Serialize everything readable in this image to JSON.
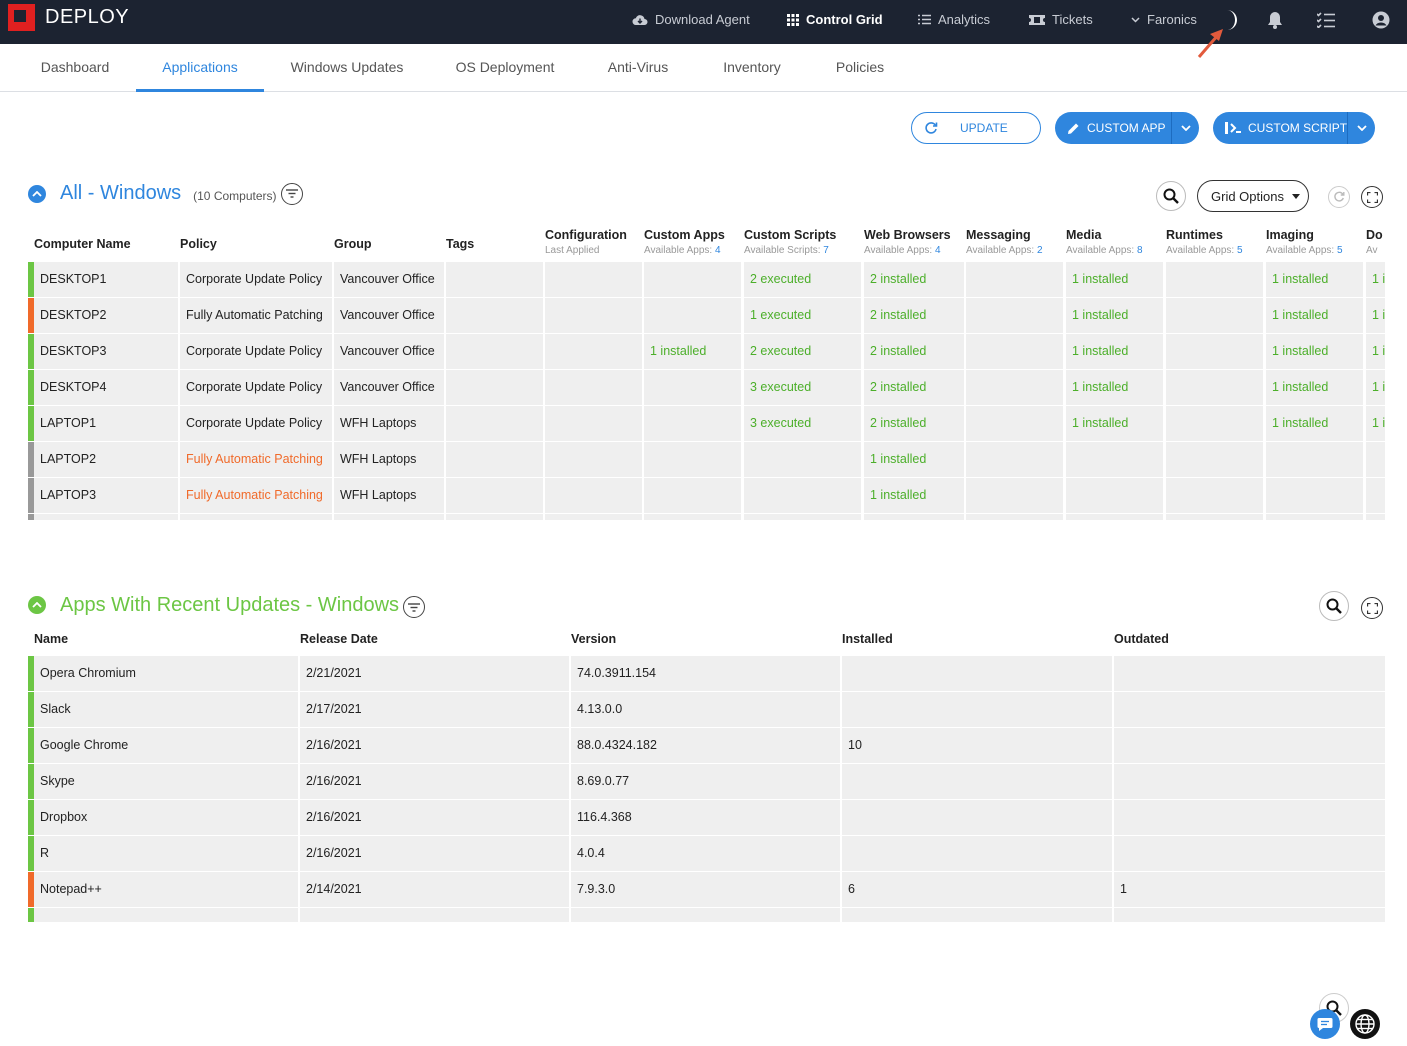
{
  "app": {
    "name": "DEPLOY"
  },
  "topnav": {
    "download_agent": "Download Agent",
    "control_grid": "Control Grid",
    "analytics": "Analytics",
    "tickets": "Tickets",
    "account": "Faronics"
  },
  "tabs": [
    "Dashboard",
    "Applications",
    "Windows Updates",
    "OS Deployment",
    "Anti-Virus",
    "Inventory",
    "Policies"
  ],
  "actions": {
    "update": "UPDATE",
    "custom_app": "CUSTOM APP",
    "custom_script": "CUSTOM SCRIPT"
  },
  "grid1": {
    "title": "All - Windows",
    "count": "(10 Computers)",
    "grid_options": "Grid Options",
    "columns": [
      {
        "label": "Computer Name",
        "sub_label": "",
        "sub_value": ""
      },
      {
        "label": "Policy",
        "sub_label": "",
        "sub_value": ""
      },
      {
        "label": "Group",
        "sub_label": "",
        "sub_value": ""
      },
      {
        "label": "Tags",
        "sub_label": "",
        "sub_value": ""
      },
      {
        "label": "Configuration",
        "sub_label": "Last Applied",
        "sub_value": ""
      },
      {
        "label": "Custom Apps",
        "sub_label": "Available Apps: ",
        "sub_value": "4"
      },
      {
        "label": "Custom Scripts",
        "sub_label": "Available Scripts: ",
        "sub_value": "7"
      },
      {
        "label": "Web Browsers",
        "sub_label": "Available Apps: ",
        "sub_value": "4"
      },
      {
        "label": "Messaging",
        "sub_label": "Available Apps: ",
        "sub_value": "2"
      },
      {
        "label": "Media",
        "sub_label": "Available Apps: ",
        "sub_value": "8"
      },
      {
        "label": "Runtimes",
        "sub_label": "Available Apps: ",
        "sub_value": "5"
      },
      {
        "label": "Imaging",
        "sub_label": "Available Apps: ",
        "sub_value": "5"
      },
      {
        "label": "Do",
        "sub_label": "Av",
        "sub_value": ""
      }
    ],
    "rows": [
      {
        "status": "green",
        "name": "DESKTOP1",
        "policy": "Corporate Update Policy",
        "policy_warn": false,
        "group": "Vancouver Office",
        "tags": "",
        "config": "",
        "custom_apps": "",
        "custom_scripts": "2 executed",
        "web_browsers": "2 installed",
        "messaging": "",
        "media": "1 installed",
        "runtimes": "",
        "imaging": "1 installed",
        "last": "1 i"
      },
      {
        "status": "orange",
        "name": "DESKTOP2",
        "policy": "Fully Automatic Patching",
        "policy_warn": false,
        "group": "Vancouver Office",
        "tags": "",
        "config": "",
        "custom_apps": "",
        "custom_scripts": "1 executed",
        "web_browsers": "2 installed",
        "messaging": "",
        "media": "1 installed",
        "runtimes": "",
        "imaging": "1 installed",
        "last": "1 i"
      },
      {
        "status": "green",
        "name": "DESKTOP3",
        "policy": "Corporate Update Policy",
        "policy_warn": false,
        "group": "Vancouver Office",
        "tags": "",
        "config": "",
        "custom_apps": "1 installed",
        "custom_scripts": "2 executed",
        "web_browsers": "2 installed",
        "messaging": "",
        "media": "1 installed",
        "runtimes": "",
        "imaging": "1 installed",
        "last": "1 i"
      },
      {
        "status": "green",
        "name": "DESKTOP4",
        "policy": "Corporate Update Policy",
        "policy_warn": false,
        "group": "Vancouver Office",
        "tags": "",
        "config": "",
        "custom_apps": "",
        "custom_scripts": "3 executed",
        "web_browsers": "2 installed",
        "messaging": "",
        "media": "1 installed",
        "runtimes": "",
        "imaging": "1 installed",
        "last": "1 i"
      },
      {
        "status": "green",
        "name": "LAPTOP1",
        "policy": "Corporate Update Policy",
        "policy_warn": false,
        "group": "WFH Laptops",
        "tags": "",
        "config": "",
        "custom_apps": "",
        "custom_scripts": "3 executed",
        "web_browsers": "2 installed",
        "messaging": "",
        "media": "1 installed",
        "runtimes": "",
        "imaging": "1 installed",
        "last": "1 i"
      },
      {
        "status": "gray",
        "name": "LAPTOP2",
        "policy": "Fully Automatic Patching",
        "policy_warn": true,
        "group": "WFH Laptops",
        "tags": "",
        "config": "",
        "custom_apps": "",
        "custom_scripts": "",
        "web_browsers": "1 installed",
        "messaging": "",
        "media": "",
        "runtimes": "",
        "imaging": "",
        "last": ""
      },
      {
        "status": "gray",
        "name": "LAPTOP3",
        "policy": "Fully Automatic Patching",
        "policy_warn": true,
        "group": "WFH Laptops",
        "tags": "",
        "config": "",
        "custom_apps": "",
        "custom_scripts": "",
        "web_browsers": "1 installed",
        "messaging": "",
        "media": "",
        "runtimes": "",
        "imaging": "",
        "last": ""
      },
      {
        "status": "gray",
        "name": "",
        "policy": "",
        "policy_warn": false,
        "group": "",
        "tags": "",
        "config": "",
        "custom_apps": "",
        "custom_scripts": "",
        "web_browsers": "",
        "messaging": "",
        "media": "",
        "runtimes": "",
        "imaging": "",
        "last": ""
      }
    ]
  },
  "grid2": {
    "title": "Apps With Recent Updates - Windows",
    "columns": [
      "Name",
      "Release Date",
      "Version",
      "Installed",
      "Outdated"
    ],
    "rows": [
      {
        "status": "green",
        "name": "Opera Chromium",
        "release": "2/21/2021",
        "version": "74.0.3911.154",
        "installed": "",
        "outdated": ""
      },
      {
        "status": "green",
        "name": "Slack",
        "release": "2/17/2021",
        "version": "4.13.0.0",
        "installed": "",
        "outdated": ""
      },
      {
        "status": "green",
        "name": "Google Chrome",
        "release": "2/16/2021",
        "version": "88.0.4324.182",
        "installed": "10",
        "outdated": ""
      },
      {
        "status": "green",
        "name": "Skype",
        "release": "2/16/2021",
        "version": "8.69.0.77",
        "installed": "",
        "outdated": ""
      },
      {
        "status": "green",
        "name": "Dropbox",
        "release": "2/16/2021",
        "version": "116.4.368",
        "installed": "",
        "outdated": ""
      },
      {
        "status": "green",
        "name": "R",
        "release": "2/16/2021",
        "version": "4.0.4",
        "installed": "",
        "outdated": ""
      },
      {
        "status": "orange",
        "name": "Notepad++",
        "release": "2/14/2021",
        "version": "7.9.3.0",
        "installed": "6",
        "outdated": "1"
      },
      {
        "status": "green",
        "name": "",
        "release": "",
        "version": "",
        "installed": "",
        "outdated": ""
      }
    ]
  },
  "colors": {
    "accent": "#2f86de",
    "green": "#6cc644",
    "orange": "#f06a2a",
    "topbar": "#1c2331"
  }
}
